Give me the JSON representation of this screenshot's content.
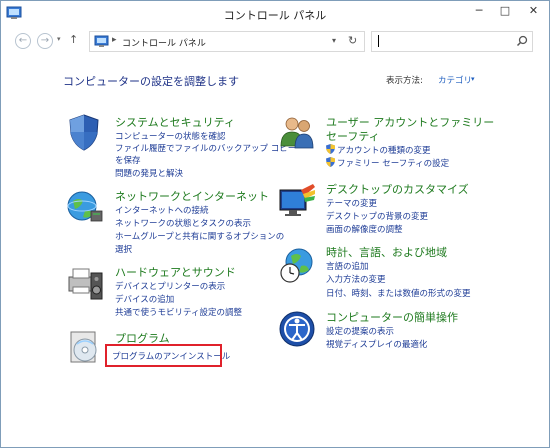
{
  "window": {
    "title": "コントロール パネル",
    "minimize": "─",
    "maximize": "□",
    "close": "✕"
  },
  "nav": {
    "back": "←",
    "forward": "→",
    "recent": "▾",
    "up": "↑",
    "breadcrumb_separator": "▸",
    "address": "コントロール パネル",
    "address_dropdown": "▾",
    "refresh": "↻",
    "search_value": "",
    "search_placeholder": ""
  },
  "content": {
    "heading": "コンピューターの設定を調整します",
    "view_by_label": "表示方法:",
    "view_by_value": "カテゴリ",
    "view_by_arrow": "▾",
    "categories": [
      {
        "title": "システムとセキュリティ",
        "links": [
          "コンピューターの状態を確認",
          "ファイル履歴でファイルのバックアップ コピー",
          "を保存",
          "問題の発見と解決"
        ]
      },
      {
        "title": "ネットワークとインターネット",
        "links": [
          "インターネットへの接続",
          "ネットワークの状態とタスクの表示",
          "ホームグループと共有に関するオプションの",
          "選択"
        ]
      },
      {
        "title": "ハードウェアとサウンド",
        "links": [
          "デバイスとプリンターの表示",
          "デバイスの追加",
          "共通で使うモビリティ設定の調整"
        ]
      },
      {
        "title": "プログラム",
        "links": [
          "プログラムのアンインストール"
        ]
      },
      {
        "title_line1": "ユーザー アカウントとファミリー",
        "title_line2": "セーフティ",
        "links": [
          "アカウントの種類の変更",
          "ファミリー セーフティの設定"
        ]
      },
      {
        "title": "デスクトップのカスタマイズ",
        "links": [
          "テーマの変更",
          "デスクトップの背景の変更",
          "画面の解像度の調整"
        ]
      },
      {
        "title": "時計、言語、および地域",
        "links": [
          "言語の追加",
          "入力方法の変更",
          "日付、時刻、または数値の形式の変更"
        ]
      },
      {
        "title": "コンピューターの簡単操作",
        "links": [
          "設定の提案の表示",
          "視覚ディスプレイの最適化"
        ]
      }
    ]
  },
  "colors": {
    "heading": "#1e3287",
    "category_title": "#1e7a1e",
    "link": "#1e3c96",
    "highlight": "#e0212b"
  }
}
